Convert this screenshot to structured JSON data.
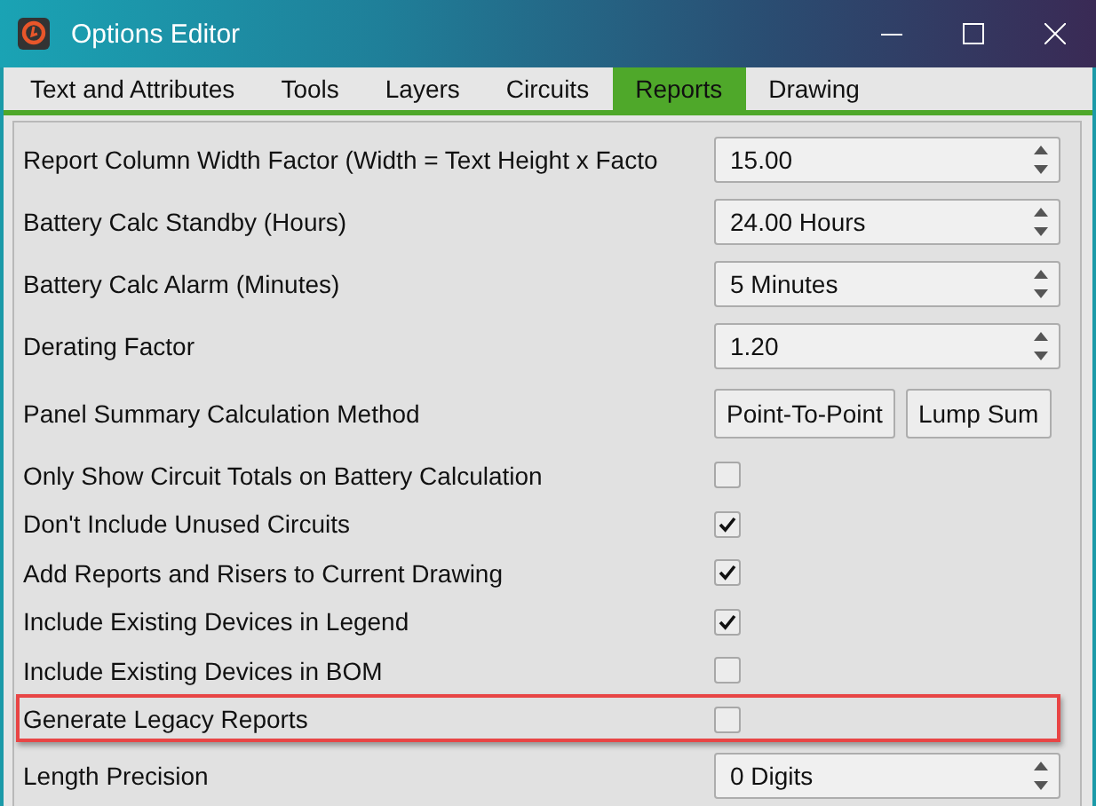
{
  "window": {
    "title": "Options Editor"
  },
  "tabs": [
    {
      "label": "Text and Attributes",
      "selected": false
    },
    {
      "label": "Tools",
      "selected": false
    },
    {
      "label": "Layers",
      "selected": false
    },
    {
      "label": "Circuits",
      "selected": false
    },
    {
      "label": "Reports",
      "selected": true
    },
    {
      "label": "Drawing",
      "selected": false
    }
  ],
  "settings": [
    {
      "kind": "spin",
      "label": "Report Column Width Factor (Width = Text Height x Facto",
      "value": "15.00",
      "highlighted": false
    },
    {
      "kind": "spin",
      "label": "Battery Calc Standby (Hours)",
      "value": "24.00 Hours",
      "highlighted": false
    },
    {
      "kind": "spin",
      "label": "Battery Calc Alarm (Minutes)",
      "value": "5 Minutes",
      "highlighted": false
    },
    {
      "kind": "spin",
      "label": "Derating Factor",
      "value": "1.20",
      "highlighted": false
    },
    {
      "kind": "buttons",
      "label": "Panel Summary Calculation Method",
      "buttons": [
        "Point-To-Point",
        "Lump Sum"
      ],
      "highlighted": false
    },
    {
      "kind": "checkbox",
      "label": "Only Show Circuit Totals on Battery Calculation",
      "checked": false,
      "highlighted": false
    },
    {
      "kind": "checkbox",
      "label": "Don't Include Unused Circuits",
      "checked": true,
      "highlighted": false
    },
    {
      "kind": "checkbox",
      "label": "Add Reports and Risers to Current Drawing",
      "checked": true,
      "highlighted": false
    },
    {
      "kind": "checkbox",
      "label": "Include Existing Devices in Legend",
      "checked": true,
      "highlighted": false
    },
    {
      "kind": "checkbox",
      "label": "Include Existing Devices in BOM",
      "checked": false,
      "highlighted": false
    },
    {
      "kind": "checkbox",
      "label": "Generate Legacy Reports",
      "checked": false,
      "highlighted": true
    },
    {
      "kind": "spin",
      "label": "Length Precision",
      "value": "0 Digits",
      "highlighted": false
    }
  ]
}
